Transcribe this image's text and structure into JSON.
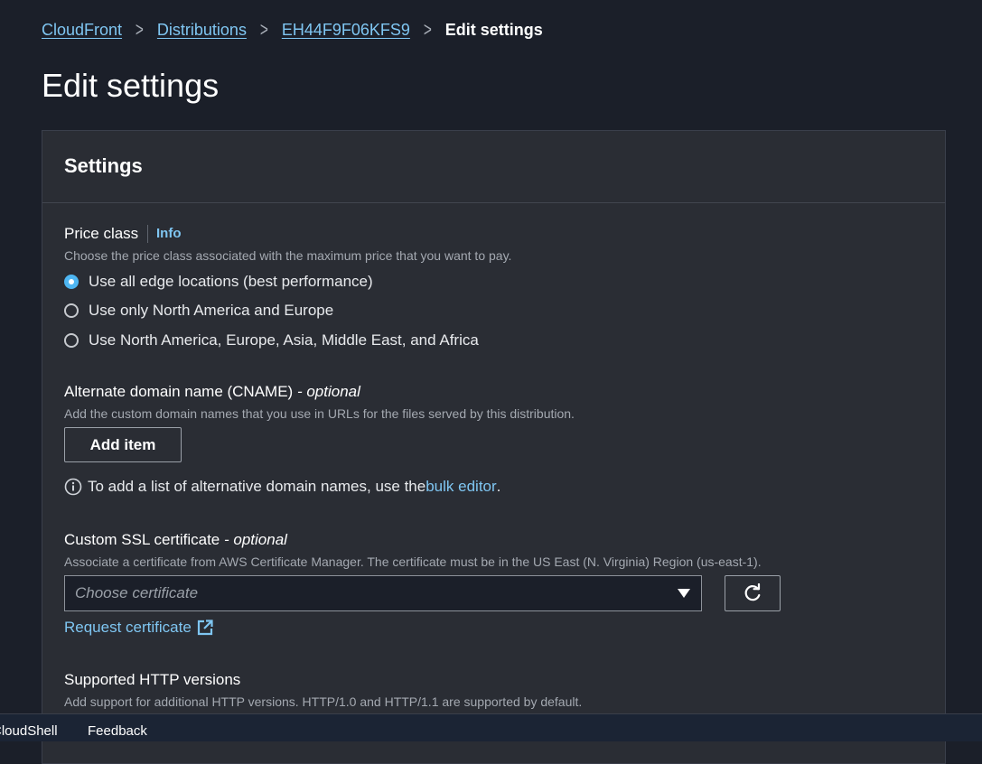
{
  "breadcrumb": {
    "items": [
      {
        "label": "CloudFront"
      },
      {
        "label": "Distributions"
      },
      {
        "label": "EH44F9F06KFS9"
      }
    ],
    "current": "Edit settings"
  },
  "page": {
    "title": "Edit settings"
  },
  "settings": {
    "heading": "Settings",
    "price_class": {
      "label": "Price class",
      "info": "Info",
      "description": "Choose the price class associated with the maximum price that you want to pay.",
      "options": [
        {
          "label": "Use all edge locations (best performance)",
          "selected": true
        },
        {
          "label": "Use only North America and Europe",
          "selected": false
        },
        {
          "label": "Use North America, Europe, Asia, Middle East, and Africa",
          "selected": false
        }
      ]
    },
    "cname": {
      "label": "Alternate domain name (CNAME)",
      "optional": " - optional",
      "description": "Add the custom domain names that you use in URLs for the files served by this distribution.",
      "add_button": "Add item",
      "hint_text": "To add a list of alternative domain names, use the ",
      "hint_link": "bulk editor",
      "hint_end": "."
    },
    "ssl": {
      "label": "Custom SSL certificate",
      "optional": " - optional",
      "description": "Associate a certificate from AWS Certificate Manager. The certificate must be in the US East (N. Virginia) Region (us-east-1).",
      "placeholder": "Choose certificate",
      "request_link": "Request certificate"
    },
    "http_versions": {
      "label": "Supported HTTP versions",
      "description": "Add support for additional HTTP versions. HTTP/1.0 and HTTP/1.1 are supported by default."
    }
  },
  "footer": {
    "cloudshell": "CloudShell",
    "feedback": "Feedback"
  },
  "colors": {
    "background": "#1b1f29",
    "panel": "#2a2d34",
    "link": "#7fc6f2",
    "radio_selected": "#4eb6f2"
  },
  "icons": [
    "chevron-right-icon",
    "info-circle-icon",
    "caret-down-icon",
    "refresh-icon",
    "external-link-icon"
  ]
}
